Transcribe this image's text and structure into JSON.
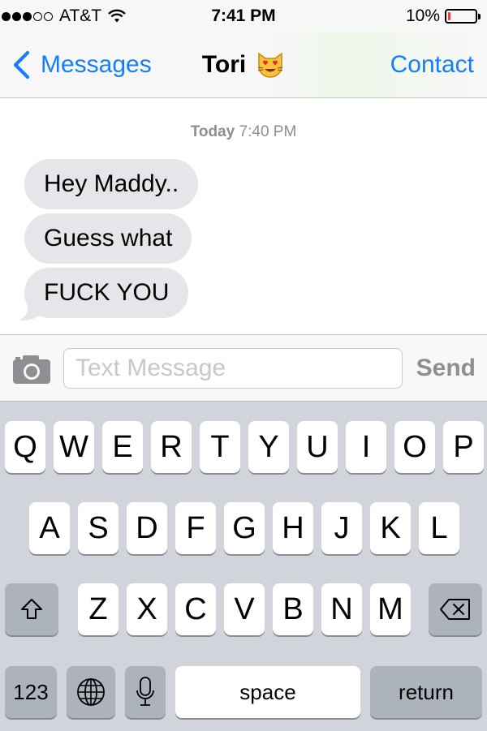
{
  "status_bar": {
    "carrier": "AT&T",
    "signal_bars_filled": 3,
    "signal_bars_total": 5,
    "time": "7:41 PM",
    "battery_percent_label": "10%",
    "battery_level": 0.1,
    "battery_color": "#ff3b30"
  },
  "nav": {
    "back_label": "Messages",
    "title": "Tori",
    "title_icon": "smiling-cat-heart-eyes-emoji",
    "right_label": "Contact",
    "accent_color": "#147efb"
  },
  "conversation": {
    "timestamp_day": "Today",
    "timestamp_time": "7:40 PM",
    "messages": [
      {
        "text": "Hey Maddy..",
        "direction": "incoming"
      },
      {
        "text": "Guess what",
        "direction": "incoming"
      },
      {
        "text": "FUCK YOU",
        "direction": "incoming"
      }
    ]
  },
  "composer": {
    "camera_icon": "camera-icon",
    "placeholder": "Text Message",
    "value": "",
    "send_label": "Send"
  },
  "keyboard": {
    "row1": [
      "Q",
      "W",
      "E",
      "R",
      "T",
      "Y",
      "U",
      "I",
      "O",
      "P"
    ],
    "row2": [
      "A",
      "S",
      "D",
      "F",
      "G",
      "H",
      "J",
      "K",
      "L"
    ],
    "row3": [
      "Z",
      "X",
      "C",
      "V",
      "B",
      "N",
      "M"
    ],
    "shift_icon": "shift-icon",
    "delete_icon": "delete-icon",
    "numbers_label": "123",
    "globe_icon": "globe-icon",
    "mic_icon": "microphone-icon",
    "space_label": "space",
    "return_label": "return"
  }
}
